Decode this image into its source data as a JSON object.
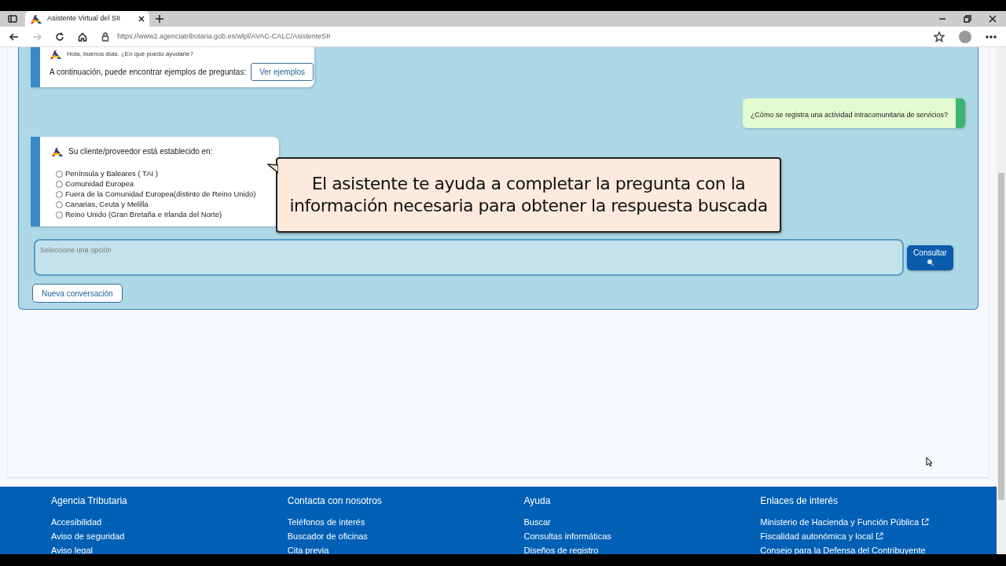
{
  "browser": {
    "tab_title": "Asistente Virtual del SII",
    "url": "https://www2.agenciatributaria.gob.es/wlpl/AVAC-CALC/AsistenteSII"
  },
  "chat": {
    "messages": [
      {
        "kind": "bot",
        "lines": [
          "Hola, buenos días. ¿En qué puedo ayudarle?"
        ],
        "prompt": "A continuación, puede encontrar ejemplos de preguntas:",
        "button": "Ver ejemplos"
      },
      {
        "kind": "user",
        "text": "¿Cómo se registra una actividad intracomunitaria de servicios?"
      },
      {
        "kind": "options",
        "question": "Su cliente/proveedor está establecido en:",
        "options": [
          {
            "label": "Península y Baleares ( TAI )",
            "selected": false
          },
          {
            "label": "Comunidad Europea",
            "selected": false
          },
          {
            "label": "Fuera de la Comunidad Europea(distinto de Reino Unido)",
            "selected": false
          },
          {
            "label": "Canarias, Ceuta y Melilla",
            "selected": false
          },
          {
            "label": "Reino Unido (Gran Bretaña e Irlanda del Norte)",
            "selected": false
          }
        ]
      }
    ],
    "input": {
      "placeholder": "Seleccione una opción"
    },
    "submit": "Consultar",
    "new_conversation": "Nueva conversación"
  },
  "callout": {
    "text": "El asistente te ayuda a completar la pregunta con la información necesaria para obtener la respuesta buscada"
  },
  "footer": {
    "columns": [
      {
        "title": "Agencia Tributaria",
        "links": [
          {
            "label": "Accesibilidad",
            "external": false
          },
          {
            "label": "Aviso de seguridad",
            "external": false
          },
          {
            "label": "Aviso legal",
            "external": false
          }
        ]
      },
      {
        "title": "Contacta con nosotros",
        "links": [
          {
            "label": "Teléfonos de interés",
            "external": false
          },
          {
            "label": "Buscador de oficinas",
            "external": false
          },
          {
            "label": "Cita previa",
            "external": false
          }
        ]
      },
      {
        "title": "Ayuda",
        "links": [
          {
            "label": "Buscar",
            "external": false
          },
          {
            "label": "Consultas informáticas",
            "external": false
          },
          {
            "label": "Diseños de registro",
            "external": false
          }
        ]
      },
      {
        "title": "Enlaces de interés",
        "links": [
          {
            "label": "Ministerio de Hacienda y Función Pública",
            "external": true
          },
          {
            "label": "Fiscalidad autonómica y local",
            "external": true
          },
          {
            "label": "Consejo para la Defensa del Contribuyente",
            "external": false
          }
        ]
      }
    ]
  }
}
